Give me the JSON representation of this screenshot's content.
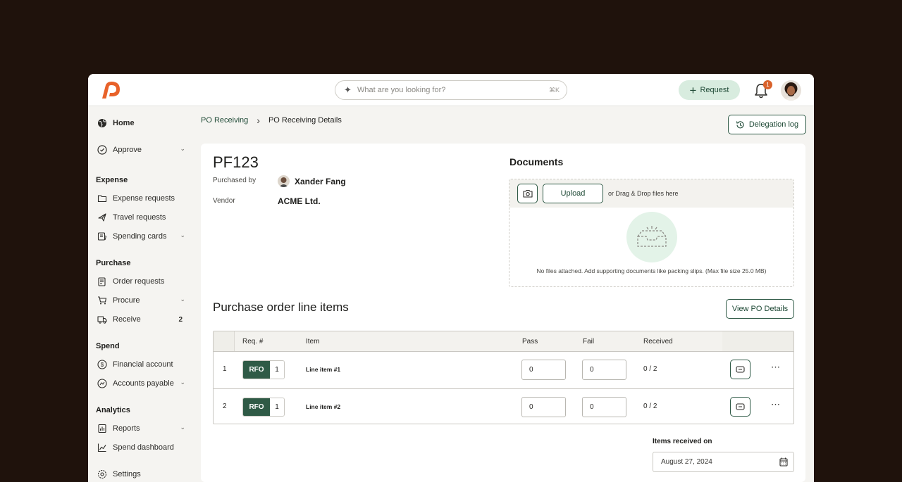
{
  "search": {
    "placeholder": "What are you looking for?",
    "shortcut": "⌘K"
  },
  "header": {
    "request_label": "Request",
    "notification_count": "1"
  },
  "sidebar": {
    "home": "Home",
    "approve": "Approve",
    "sections": {
      "expense": "Expense",
      "purchase": "Purchase",
      "spend": "Spend",
      "analytics": "Analytics"
    },
    "expense_items": [
      "Expense requests",
      "Travel requests",
      "Spending cards"
    ],
    "purchase_items": [
      "Order requests",
      "Procure",
      "Receive"
    ],
    "receive_count": "2",
    "spend_items": [
      "Financial account",
      "Accounts payable"
    ],
    "analytics_items": [
      "Reports",
      "Spend dashboard"
    ],
    "settings": "Settings"
  },
  "breadcrumb": {
    "parent": "PO Receiving",
    "current": "PO Receiving Details"
  },
  "delegation_label": "Delegation log",
  "po": {
    "id": "PF123",
    "purchased_by_label": "Purchased by",
    "purchased_by": "Xander Fang",
    "vendor_label": "Vendor",
    "vendor": "ACME Ltd."
  },
  "documents": {
    "title": "Documents",
    "upload_label": "Upload",
    "drag_text": "or Drag & Drop files here",
    "empty_text": "No files attached. Add supporting documents like packing slips. (Max file size 25.0 MB)"
  },
  "line_items": {
    "title": "Purchase order line items",
    "view_po_label": "View PO Details",
    "columns": {
      "req": "Req. #",
      "item": "Item",
      "pass": "Pass",
      "fail": "Fail",
      "received": "Received"
    },
    "rows": [
      {
        "index": "1",
        "tag": "RFO",
        "tag_num": "1",
        "item": "Line item #1",
        "pass": "0",
        "fail": "0",
        "received": "0 / 2"
      },
      {
        "index": "2",
        "tag": "RFO",
        "tag_num": "1",
        "item": "Line item #2",
        "pass": "0",
        "fail": "0",
        "received": "0 / 2"
      }
    ]
  },
  "received_on": {
    "label": "Items received on",
    "date": "August 27, 2024"
  },
  "colors": {
    "brand": "#e8622a",
    "accent": "#2f5a46",
    "accent_light": "#d8ecdf",
    "badge": "#d9622c"
  },
  "icons": [
    "logo",
    "sparkle-icon",
    "plus-icon",
    "bell-icon",
    "globe-icon",
    "check-circle-icon",
    "folder-icon",
    "plane-icon",
    "card-icon",
    "clipboard-icon",
    "cart-icon",
    "truck-icon",
    "dollar-circle-icon",
    "circle-dollar-icon",
    "report-icon",
    "chart-icon",
    "gear-icon",
    "history-icon",
    "camera-icon",
    "inbox-icon",
    "comment-icon",
    "more-icon",
    "calendar-icon"
  ]
}
